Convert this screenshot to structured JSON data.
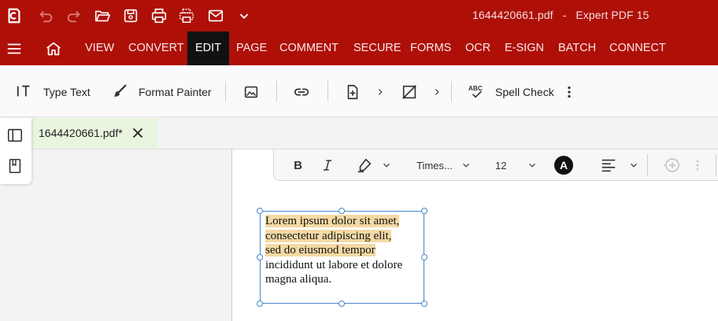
{
  "title_bar": {
    "document_title": "1644420661.pdf   -   Expert PDF 15",
    "quick_access_icons": [
      "app-logo-icon",
      "undo-icon",
      "redo-icon",
      "open-folder-icon",
      "save-icon",
      "print-icon",
      "batch-print-icon",
      "email-icon",
      "dropdown-chevron-icon"
    ]
  },
  "menu": {
    "items": [
      "VIEW",
      "CONVERT",
      "EDIT",
      "PAGE",
      "COMMENT",
      "SECURE",
      "FORMS",
      "OCR",
      "E-SIGN",
      "BATCH",
      "CONNECT"
    ],
    "active": "EDIT"
  },
  "ribbon": {
    "type_text": "Type Text",
    "format_painter": "Format Painter",
    "spell_check": "Spell Check"
  },
  "tab": {
    "label": "1644420661.pdf*"
  },
  "format_bar": {
    "font": "Times...",
    "size": "12",
    "color_letter": "A"
  },
  "text_box": {
    "highlighted_lines": [
      "Lorem ipsum dolor sit amet,",
      "consectetur adipiscing elit,",
      "sed do eiusmod tempor"
    ],
    "plain_lines": [
      "incididunt ut labore et dolore",
      "magna aliqua."
    ]
  },
  "colors": {
    "brand_red": "#ae1008",
    "active_menu_bg": "#111111",
    "highlight": "#f3d9a4",
    "selection_border": "#4a86c8"
  }
}
